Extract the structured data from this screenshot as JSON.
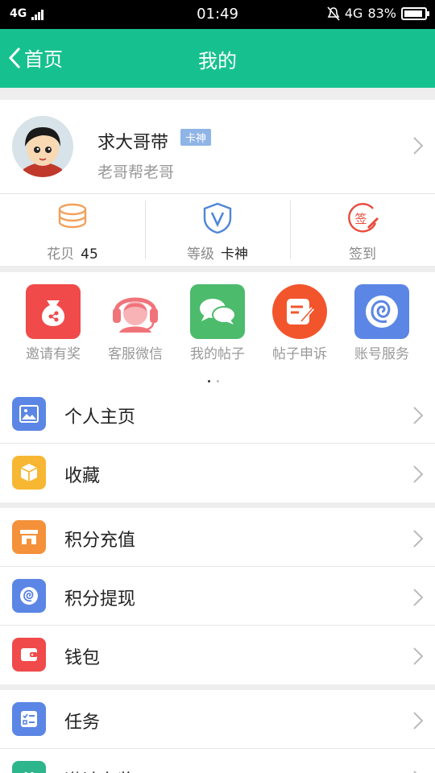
{
  "status_bar": {
    "network_left": "4G",
    "time": "01:49",
    "network_right": "4G",
    "battery": "83%"
  },
  "header": {
    "back_label": "首页",
    "title": "我的"
  },
  "profile": {
    "username": "求大哥带",
    "badge": "卡神",
    "signature": "老哥帮老哥"
  },
  "stats": [
    {
      "icon": "coins-icon",
      "label": "花贝",
      "value": "45"
    },
    {
      "icon": "shield-v-icon",
      "label": "等级",
      "value": "卡神"
    },
    {
      "icon": "checkin-icon",
      "label": "签到",
      "value": ""
    }
  ],
  "quick_actions": [
    {
      "icon": "money-bag-icon",
      "label": "邀请有奖",
      "color": "#f04a4a"
    },
    {
      "icon": "headset-icon",
      "label": "客服微信",
      "color": "#f1737a"
    },
    {
      "icon": "chat-bubbles-icon",
      "label": "我的帖子",
      "color": "#4cbb6c"
    },
    {
      "icon": "edit-note-icon",
      "label": "帖子申诉",
      "color": "#f2552c"
    },
    {
      "icon": "spiral-icon",
      "label": "账号服务",
      "color": "#5b86e5"
    }
  ],
  "menu_groups": [
    [
      {
        "icon": "image-icon",
        "label": "个人主页",
        "color": "#5b86e5"
      },
      {
        "icon": "box-icon",
        "label": "收藏",
        "color": "#f7b733"
      }
    ],
    [
      {
        "icon": "store-icon",
        "label": "积分充值",
        "color": "#f5913a"
      },
      {
        "icon": "spiral-icon",
        "label": "积分提现",
        "color": "#5b86e5"
      },
      {
        "icon": "wallet-icon",
        "label": "钱包",
        "color": "#f04a4a"
      }
    ],
    [
      {
        "icon": "task-list-icon",
        "label": "任务",
        "color": "#5b86e5"
      },
      {
        "icon": "gift-icon",
        "label": "邀请有奖",
        "color": "#2db58b"
      }
    ]
  ]
}
